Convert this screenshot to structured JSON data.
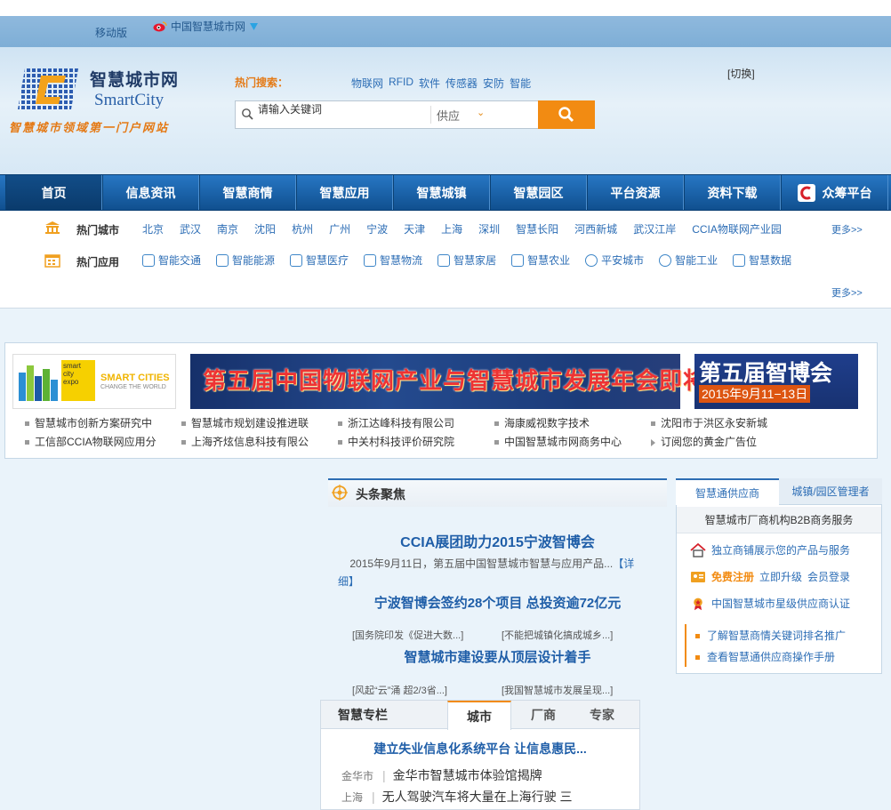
{
  "topbar": {
    "mobile": "移动版",
    "weibo": "中国智慧城市网"
  },
  "logo": {
    "cn": "智慧城市网",
    "en": "SmartCity",
    "slogan": "智慧城市领域第一门户网站"
  },
  "search": {
    "hot_label": "热门搜索：",
    "hot_words": [
      "物联网",
      "RFID",
      "软件",
      "传感器",
      "安防",
      "智能"
    ],
    "placeholder": "请输入关键词",
    "type": "供应",
    "switch": "[切换]"
  },
  "nav": [
    "首页",
    "信息资讯",
    "智慧商情",
    "智慧应用",
    "智慧城镇",
    "智慧园区",
    "平台资源",
    "资料下载",
    "众筹平台"
  ],
  "hot_cities": {
    "label": "热门城市",
    "items": [
      "北京",
      "武汉",
      "南京",
      "沈阳",
      "杭州",
      "广州",
      "宁波",
      "天津",
      "上海",
      "深圳",
      "智慧长阳",
      "河西新城",
      "武汉江岸",
      "CCIA物联网产业园"
    ],
    "more": "更多>>"
  },
  "hot_apps": {
    "label": "热门应用",
    "items": [
      "智能交通",
      "智能能源",
      "智慧医疗",
      "智慧物流",
      "智慧家居",
      "智慧农业",
      "平安城市",
      "智能工业",
      "智慧数据"
    ],
    "more": "更多>>"
  },
  "ads": {
    "ad1": {
      "line1": "smart",
      "line2": "city",
      "line3": "expo",
      "title": "SMART CITIES",
      "sub": "CHANGE THE WORLD"
    },
    "ad2": "第五届中国物联网产业与智慧城市发展年会即将开幕",
    "ad3": {
      "title": "第五届智博会",
      "date": "2015年9月11−13日"
    },
    "links_row1": [
      "智慧城市创新方案研究中",
      "智慧城市规划建设推进联",
      "浙江达峰科技有限公司",
      "海康威视数字技术",
      "沈阳市于洪区永安新城"
    ],
    "links_row2": [
      "工信部CCIA物联网应用分",
      "上海齐炫信息科技有限公",
      "中关村科技评价研究院",
      "中国智慧城市网商务中心",
      "订阅您的黄金广告位"
    ]
  },
  "focus": {
    "title": "头条聚焦",
    "headline1": "CCIA展团助力2015宁波智博会",
    "headline1_summary": "2015年9月11日，第五届中国智慧城市智慧与应用产品...",
    "detail": "【详细】",
    "headline2": "宁波智博会签约28个项目 总投资逾72亿元",
    "sub1a": "[国务院印发《促进大数...]",
    "sub1b": "[不能把城镇化搞成城乡...]",
    "headline3": "智慧城市建设要从顶层设计着手",
    "sub2a": "[风起“云”涌 超2/3省...]",
    "sub2b": "[我国智慧城市发展呈现...]"
  },
  "column": {
    "title": "智慧专栏",
    "tabs": [
      "城市",
      "厂商",
      "专家"
    ],
    "headline": "建立失业信息化系统平台 让信息惠民...",
    "rows": [
      {
        "city": "金华市",
        "text": "金华市智慧城市体验馆揭牌"
      },
      {
        "city": "上海",
        "text": "无人驾驶汽车将大量在上海行驶 三"
      }
    ]
  },
  "right": {
    "tab1": "智慧通供应商",
    "tab2": "城镇/园区管理者",
    "subtitle": "智慧城市厂商机构B2B商务服务",
    "row1": "独立商铺展示您的产品与服务",
    "row2_free": "免费注册",
    "row2_upgrade": "立即升级",
    "row2_login": "会员登录",
    "row3": "中国智慧城市星级供应商认证",
    "link1": "了解智慧商情关键词排名推广",
    "link2": "查看智慧通供应商操作手册"
  }
}
